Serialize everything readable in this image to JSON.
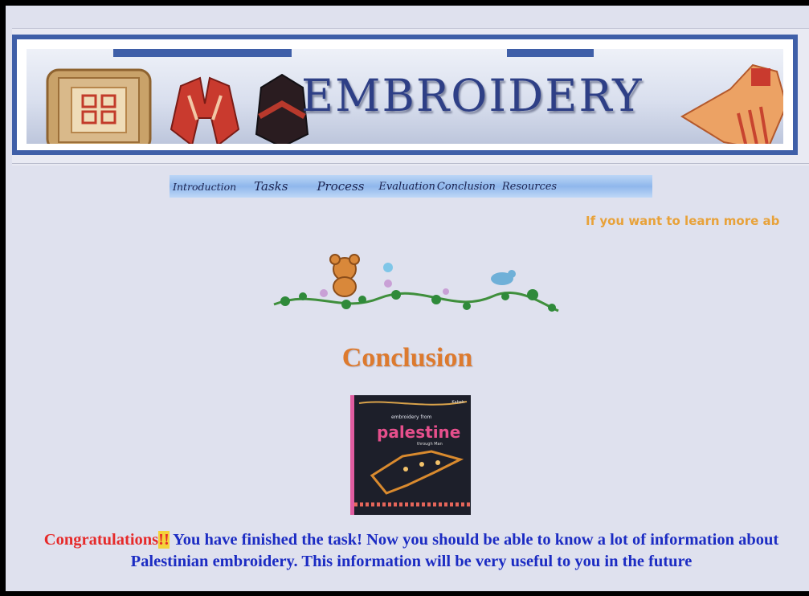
{
  "header": {
    "title": "EMBROIDERY",
    "colors": {
      "frame": "#3f5fa8",
      "title": "#2e3f86"
    }
  },
  "nav": {
    "items": [
      {
        "label": "Introduction"
      },
      {
        "label": "Tasks"
      },
      {
        "label": "Process"
      },
      {
        "label": "Evaluation"
      },
      {
        "label": "Conclusion"
      },
      {
        "label": "Resources"
      }
    ]
  },
  "marquee": {
    "text": "If you want to learn more ab"
  },
  "main": {
    "heading": "Conclusion",
    "book": {
      "publisher": "Kabeh",
      "small_title": "embroidery from",
      "title": "palestine",
      "subtitle": "through Man"
    },
    "message": {
      "congrats": "Congratulations",
      "bang": "!!",
      "body": " You have finished the task! Now you should be able to know a lot of information about Palestinian embroidery. This information will be very useful to you in the future"
    }
  }
}
